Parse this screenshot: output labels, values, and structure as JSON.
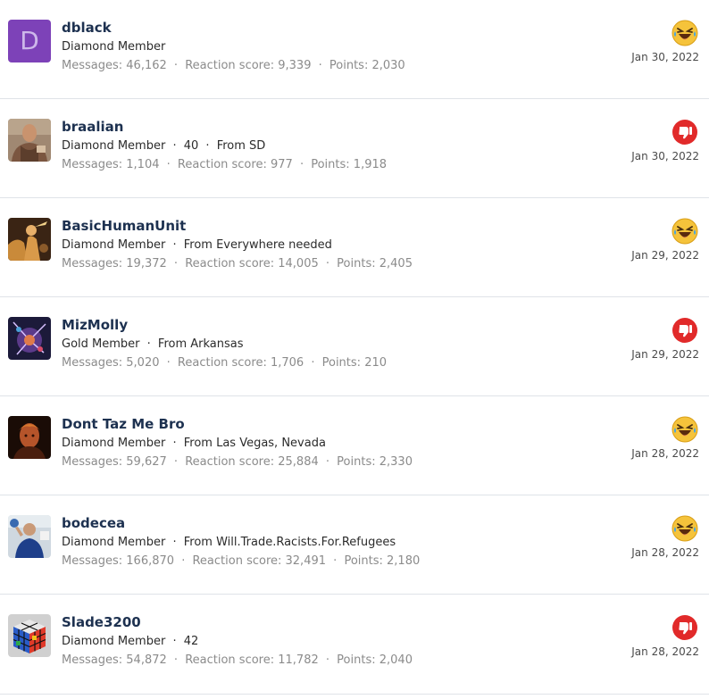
{
  "members": [
    {
      "username": "dblack",
      "avatar_letter": "D",
      "user_title": "Diamond Member",
      "extra": [],
      "messages_label": "Messages:",
      "messages": "46,162",
      "reaction_label": "Reaction score:",
      "reaction_score": "9,339",
      "points_label": "Points:",
      "points": "2,030",
      "reaction": "haha-icon",
      "date": "Jan 30, 2022"
    },
    {
      "username": "braalian",
      "user_title": "Diamond Member",
      "extra": [
        "40",
        "From SD"
      ],
      "messages_label": "Messages:",
      "messages": "1,104",
      "reaction_label": "Reaction score:",
      "reaction_score": "977",
      "points_label": "Points:",
      "points": "1,918",
      "reaction": "thumbs-down-icon",
      "date": "Jan 30, 2022"
    },
    {
      "username": "BasicHumanUnit",
      "user_title": "Diamond Member",
      "extra": [
        "From Everywhere needed"
      ],
      "messages_label": "Messages:",
      "messages": "19,372",
      "reaction_label": "Reaction score:",
      "reaction_score": "14,005",
      "points_label": "Points:",
      "points": "2,405",
      "reaction": "haha-icon",
      "date": "Jan 29, 2022"
    },
    {
      "username": "MizMolly",
      "user_title": "Gold Member",
      "extra": [
        "From Arkansas"
      ],
      "messages_label": "Messages:",
      "messages": "5,020",
      "reaction_label": "Reaction score:",
      "reaction_score": "1,706",
      "points_label": "Points:",
      "points": "210",
      "reaction": "thumbs-down-icon",
      "date": "Jan 29, 2022"
    },
    {
      "username": "Dont Taz Me Bro",
      "user_title": "Diamond Member",
      "extra": [
        "From Las Vegas, Nevada"
      ],
      "messages_label": "Messages:",
      "messages": "59,627",
      "reaction_label": "Reaction score:",
      "reaction_score": "25,884",
      "points_label": "Points:",
      "points": "2,330",
      "reaction": "haha-icon",
      "date": "Jan 28, 2022"
    },
    {
      "username": "bodecea",
      "user_title": "Diamond Member",
      "extra": [
        "From Will.Trade.Racists.For.Refugees"
      ],
      "messages_label": "Messages:",
      "messages": "166,870",
      "reaction_label": "Reaction score:",
      "reaction_score": "32,491",
      "points_label": "Points:",
      "points": "2,180",
      "reaction": "haha-icon",
      "date": "Jan 28, 2022"
    },
    {
      "username": "Slade3200",
      "user_title": "Diamond Member",
      "extra": [
        "42"
      ],
      "messages_label": "Messages:",
      "messages": "54,872",
      "reaction_label": "Reaction score:",
      "reaction_score": "11,782",
      "points_label": "Points:",
      "points": "2,040",
      "reaction": "thumbs-down-icon",
      "date": "Jan 28, 2022"
    }
  ],
  "separator": "·",
  "colors": {
    "username": "#1d3150",
    "stats": "#8b8b8b",
    "avatar_letter_bg": "#7d42b8",
    "haha_yellow": "#f5c33b",
    "dislike_red": "#e12a2a"
  }
}
